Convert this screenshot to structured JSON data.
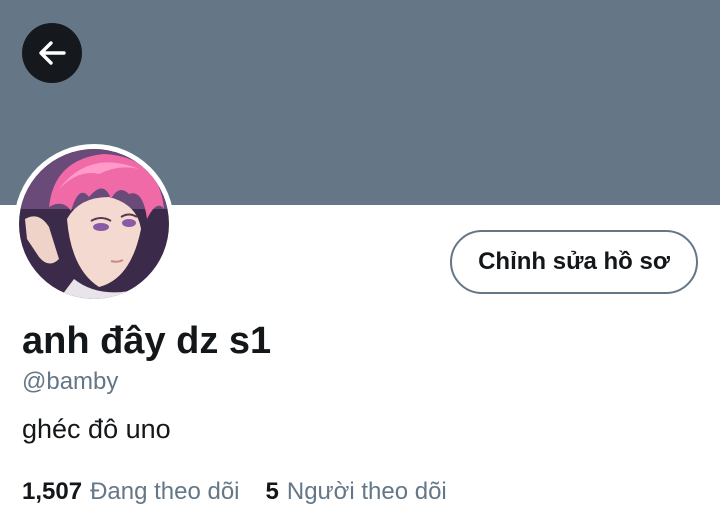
{
  "header": {
    "back_icon": "arrow-left-icon",
    "banner_color": "#657786"
  },
  "profile": {
    "display_name": "anh đây dz s1",
    "handle": "@bamby",
    "bio": "ghéc đô uno",
    "edit_button_label": "Chỉnh sửa hồ sơ",
    "following_count": "1,507",
    "following_label": "Đang theo dõi",
    "followers_count": "5",
    "followers_label": "Người theo dõi"
  },
  "colors": {
    "text_primary": "#14171a",
    "text_secondary": "#657786",
    "back_button_bg": "#15181c"
  }
}
